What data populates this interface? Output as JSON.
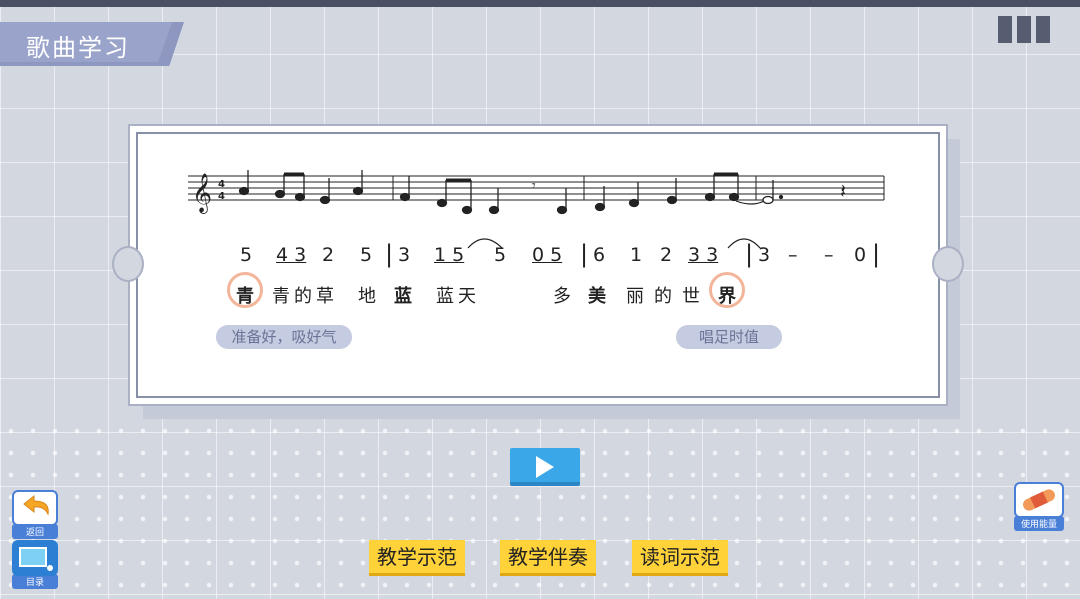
{
  "title": "歌曲学习",
  "notation": {
    "m1": [
      "5",
      "4 3",
      "2",
      "5"
    ],
    "m2": [
      "3",
      "1 5",
      "5",
      "0 5"
    ],
    "m3": [
      "6",
      "1",
      "2",
      "3 3"
    ],
    "m4": [
      "3",
      "–",
      "–",
      "0"
    ]
  },
  "lyrics": {
    "w1": "青",
    "w2": "青的草",
    "w3": "地",
    "w4": "蓝",
    "w5": "蓝天",
    "w6": "多",
    "w7": "美",
    "w8": "丽的世",
    "w9": "界"
  },
  "tips": {
    "breath": "准备好，吸好气",
    "hold": "唱足时值"
  },
  "buttons": {
    "demo": "教学示范",
    "accompany": "教学伴奏",
    "read": "读词示范"
  },
  "side": {
    "back": "返回",
    "catalog": "目录",
    "energy": "使用能量"
  },
  "colors": {
    "accent": "#3aa7e8",
    "button_yellow": "#ffd23a",
    "circle": "#f3b59a"
  }
}
